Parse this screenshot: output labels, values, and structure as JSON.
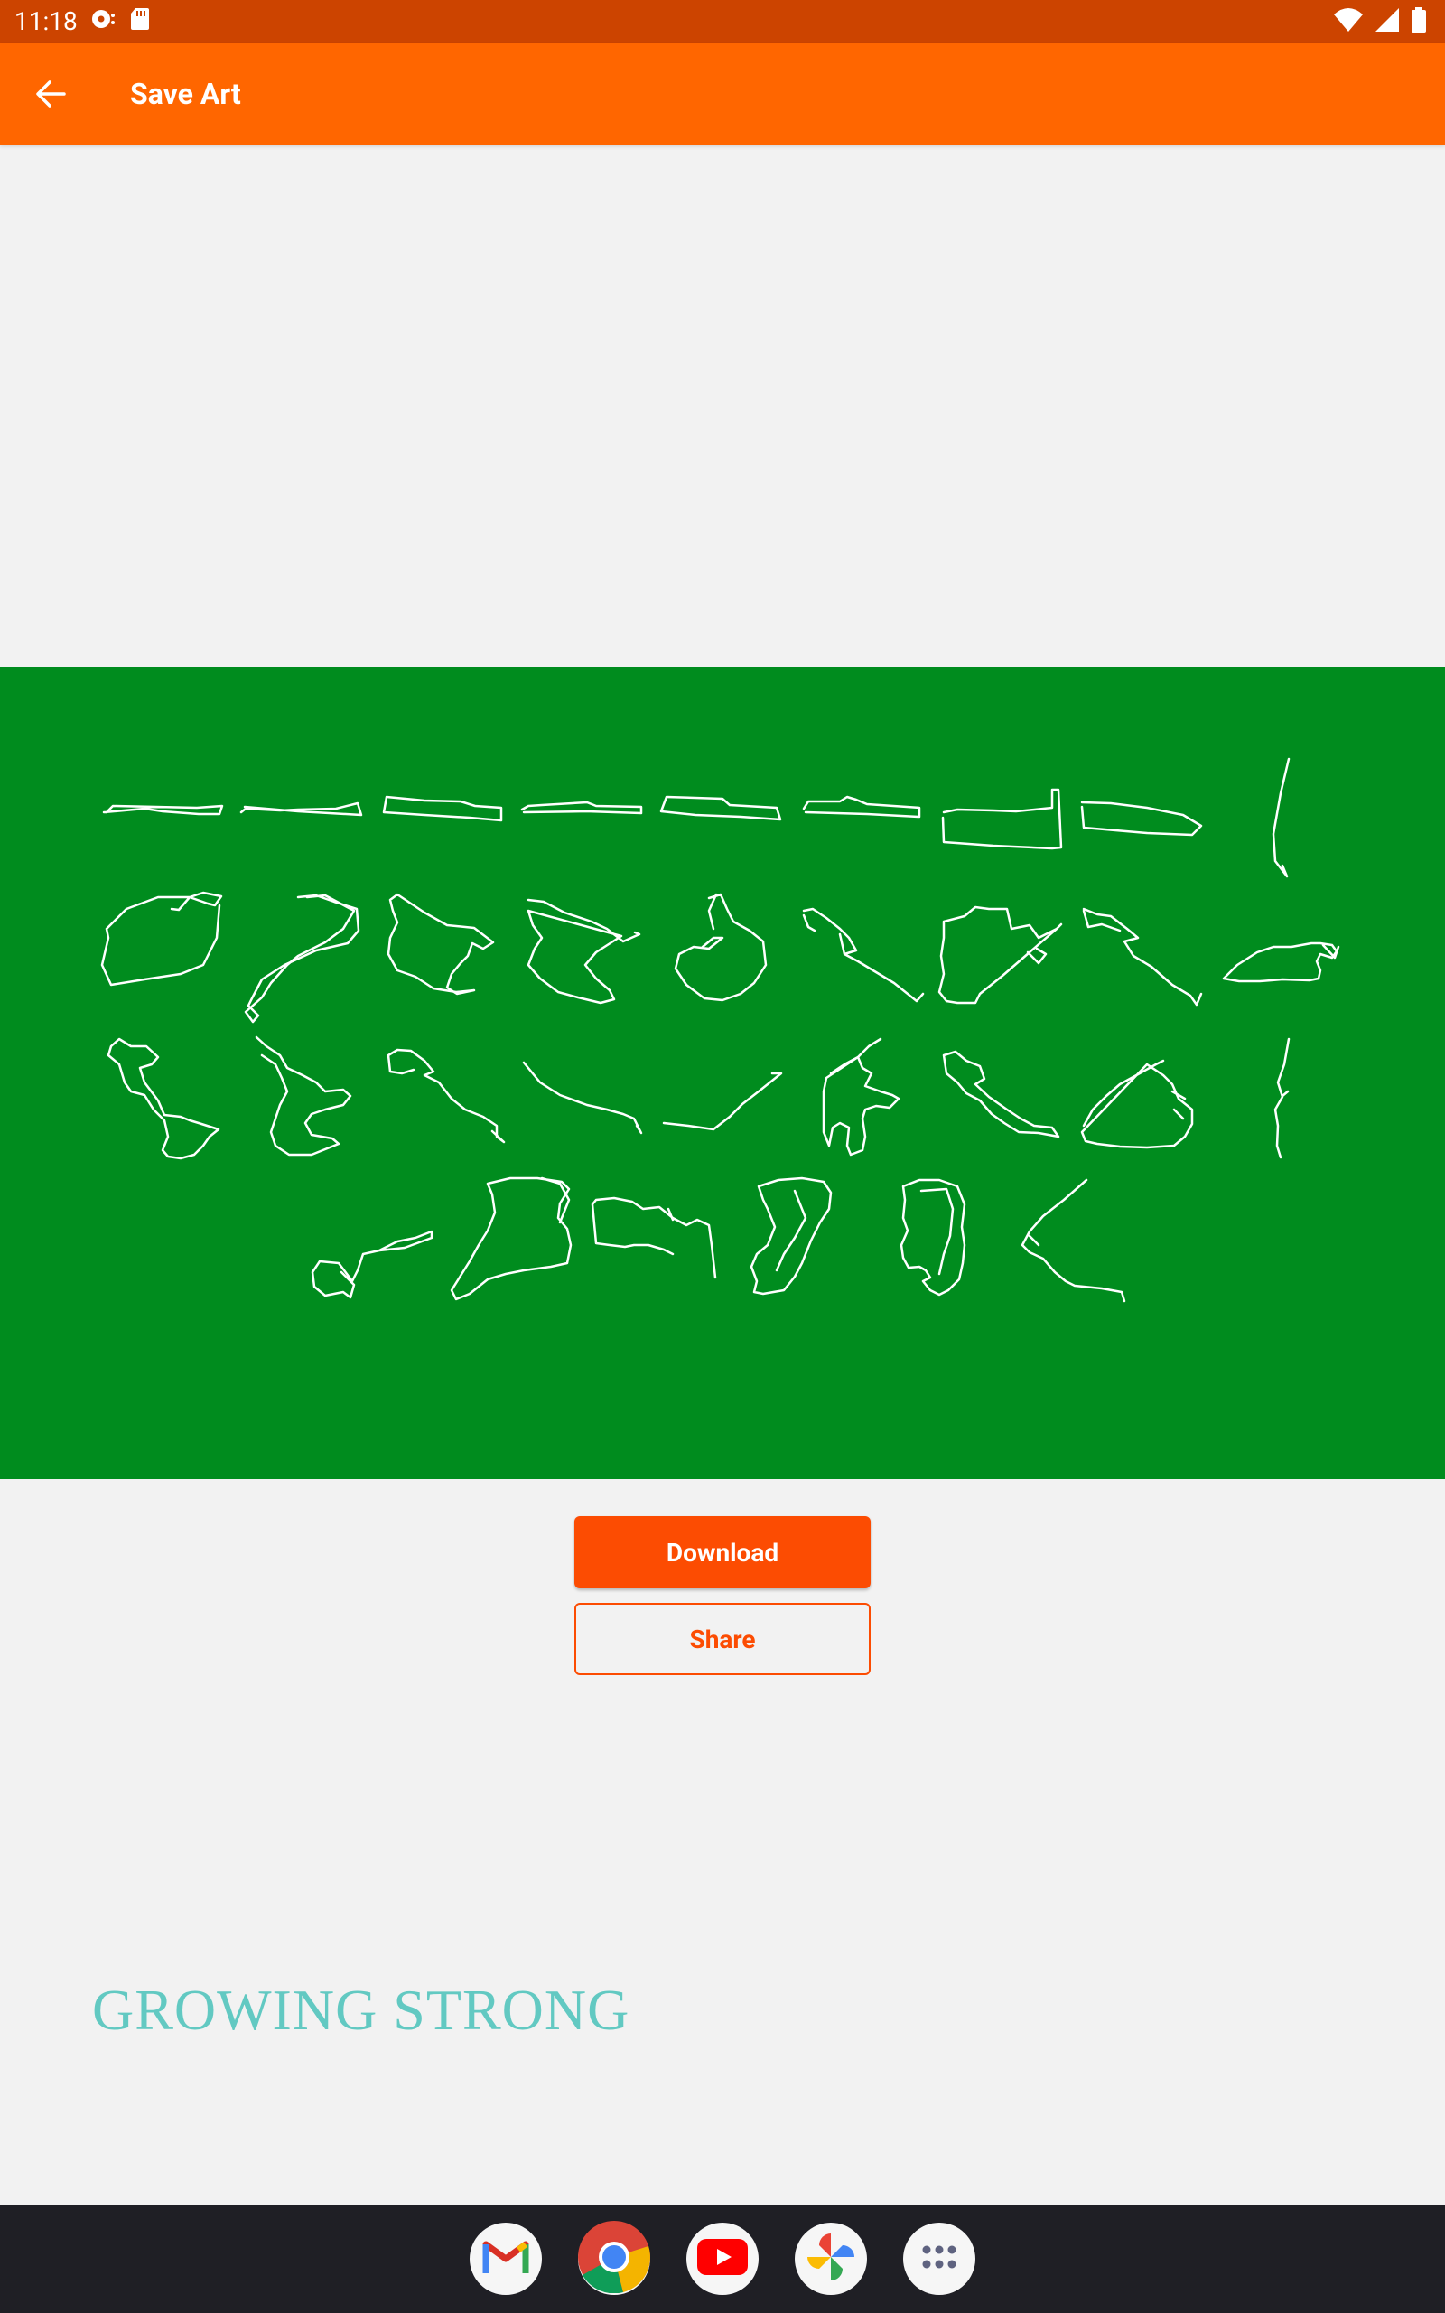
{
  "status_bar": {
    "time": "11:18",
    "icons_left": [
      "media-icon",
      "sd-card-icon"
    ],
    "icons_right": [
      "wifi-icon",
      "signal-icon",
      "battery-icon"
    ]
  },
  "app_bar": {
    "title": "Save Art",
    "back_icon": "arrow-back-icon",
    "color": "#ff6600"
  },
  "art": {
    "background_color": "#008c1e",
    "line_color": "#ffffff",
    "caption": "GROWING STRONG",
    "caption_color": "#62c9c2",
    "route_count": 34
  },
  "actions": {
    "download_label": "Download",
    "share_label": "Share",
    "accent_color": "#fc4c02"
  },
  "dock": {
    "apps": [
      "gmail-icon",
      "chrome-icon",
      "youtube-icon",
      "photos-icon",
      "app-drawer-icon"
    ]
  }
}
